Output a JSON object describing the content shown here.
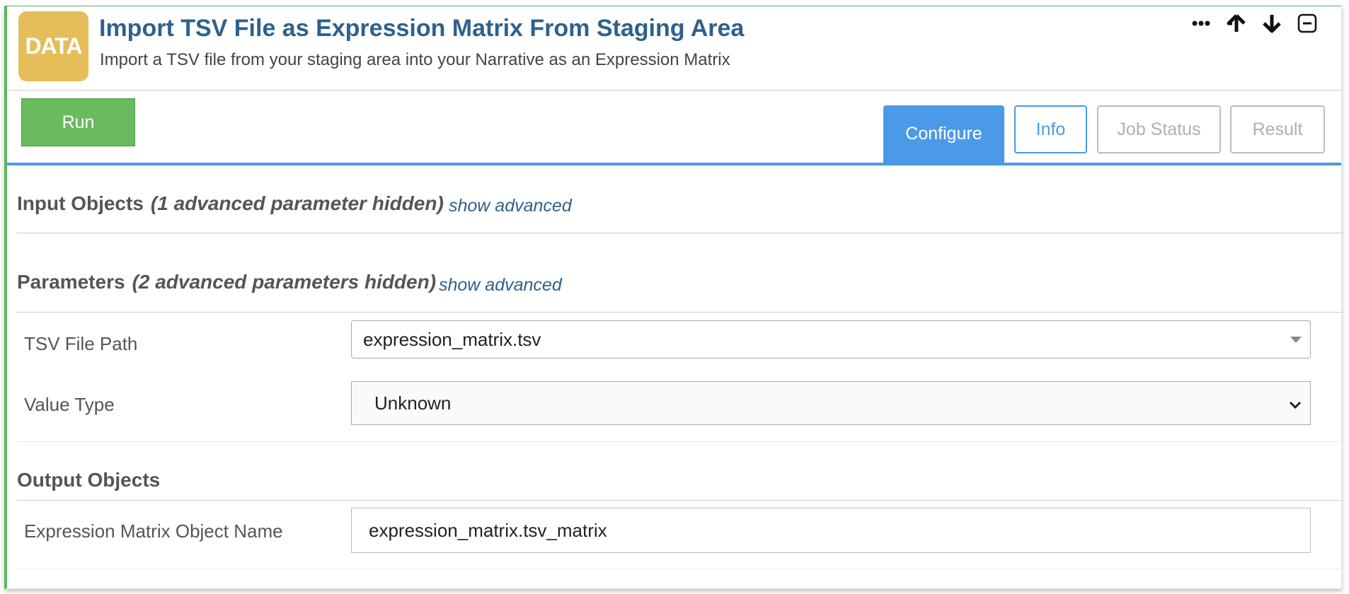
{
  "app": {
    "logo_text": "DATA",
    "title": "Import TSV File as Expression Matrix From Staging Area",
    "subtitle": "Import a TSV file from your staging area into your Narrative as an Expression Matrix",
    "controls": [
      "more-options-icon",
      "arrow-up-icon",
      "arrow-down-icon",
      "collapse-icon"
    ]
  },
  "toolbar": {
    "run_label": "Run",
    "tabs": [
      {
        "label": "Configure",
        "state": "active"
      },
      {
        "label": "Info",
        "state": "enabled"
      },
      {
        "label": "Job Status",
        "state": "disabled"
      },
      {
        "label": "Result",
        "state": "disabled"
      }
    ]
  },
  "sections": {
    "input_objects": {
      "title": "Input Objects",
      "hidden_note": "(1 advanced parameter hidden)",
      "show_advanced": "show advanced"
    },
    "parameters": {
      "title": "Parameters",
      "hidden_note": "(2 advanced parameters hidden)",
      "show_advanced": "show advanced",
      "fields": [
        {
          "label": "TSV File Path",
          "value": "expression_matrix.tsv"
        },
        {
          "label": "Value Type",
          "value": "Unknown"
        }
      ]
    },
    "output_objects": {
      "title": "Output Objects",
      "fields": [
        {
          "label": "Expression Matrix Object Name",
          "value": "expression_matrix.tsv_matrix"
        }
      ]
    }
  },
  "colors": {
    "cell_border": "#5cb85c",
    "logo_bg": "#e5bd59",
    "title": "#2e618d",
    "accent_blue": "#4a9ae8",
    "run_button": "#6aba5f"
  }
}
